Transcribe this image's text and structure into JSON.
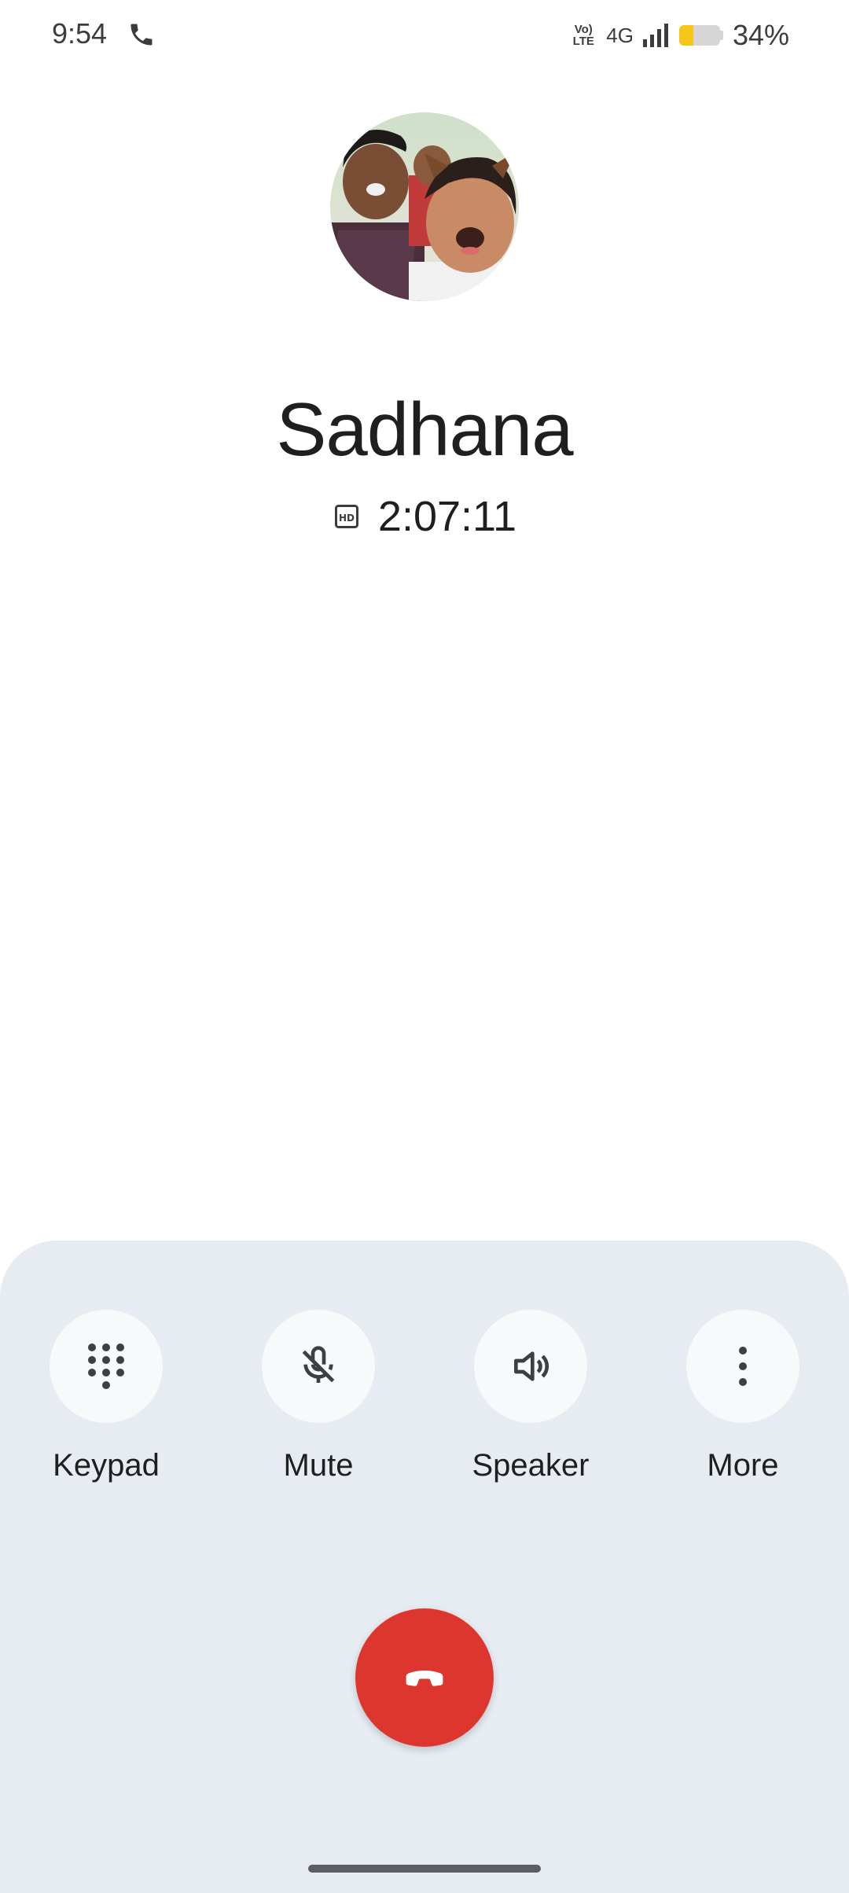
{
  "status_bar": {
    "time": "9:54",
    "volte_top": "Vo)",
    "volte_bottom": "LTE",
    "network": "4G",
    "battery_level": 0.34,
    "battery_text": "34%"
  },
  "contact": {
    "name": "Sadhana"
  },
  "call": {
    "timer": "2:07:11"
  },
  "controls": {
    "keypad_label": "Keypad",
    "mute_label": "Mute",
    "speaker_label": "Speaker",
    "more_label": "More"
  },
  "icons": {
    "call": "phone-icon",
    "hd": "hd-icon",
    "keypad": "dialpad-icon",
    "mute": "mic-off-icon",
    "speaker": "volume-icon",
    "more": "more-vertical-icon",
    "end_call": "call-end-icon"
  },
  "colors": {
    "end_call": "#dc362e",
    "panel_bg": "#e6ecf2",
    "battery_fill": "#f5c518"
  }
}
